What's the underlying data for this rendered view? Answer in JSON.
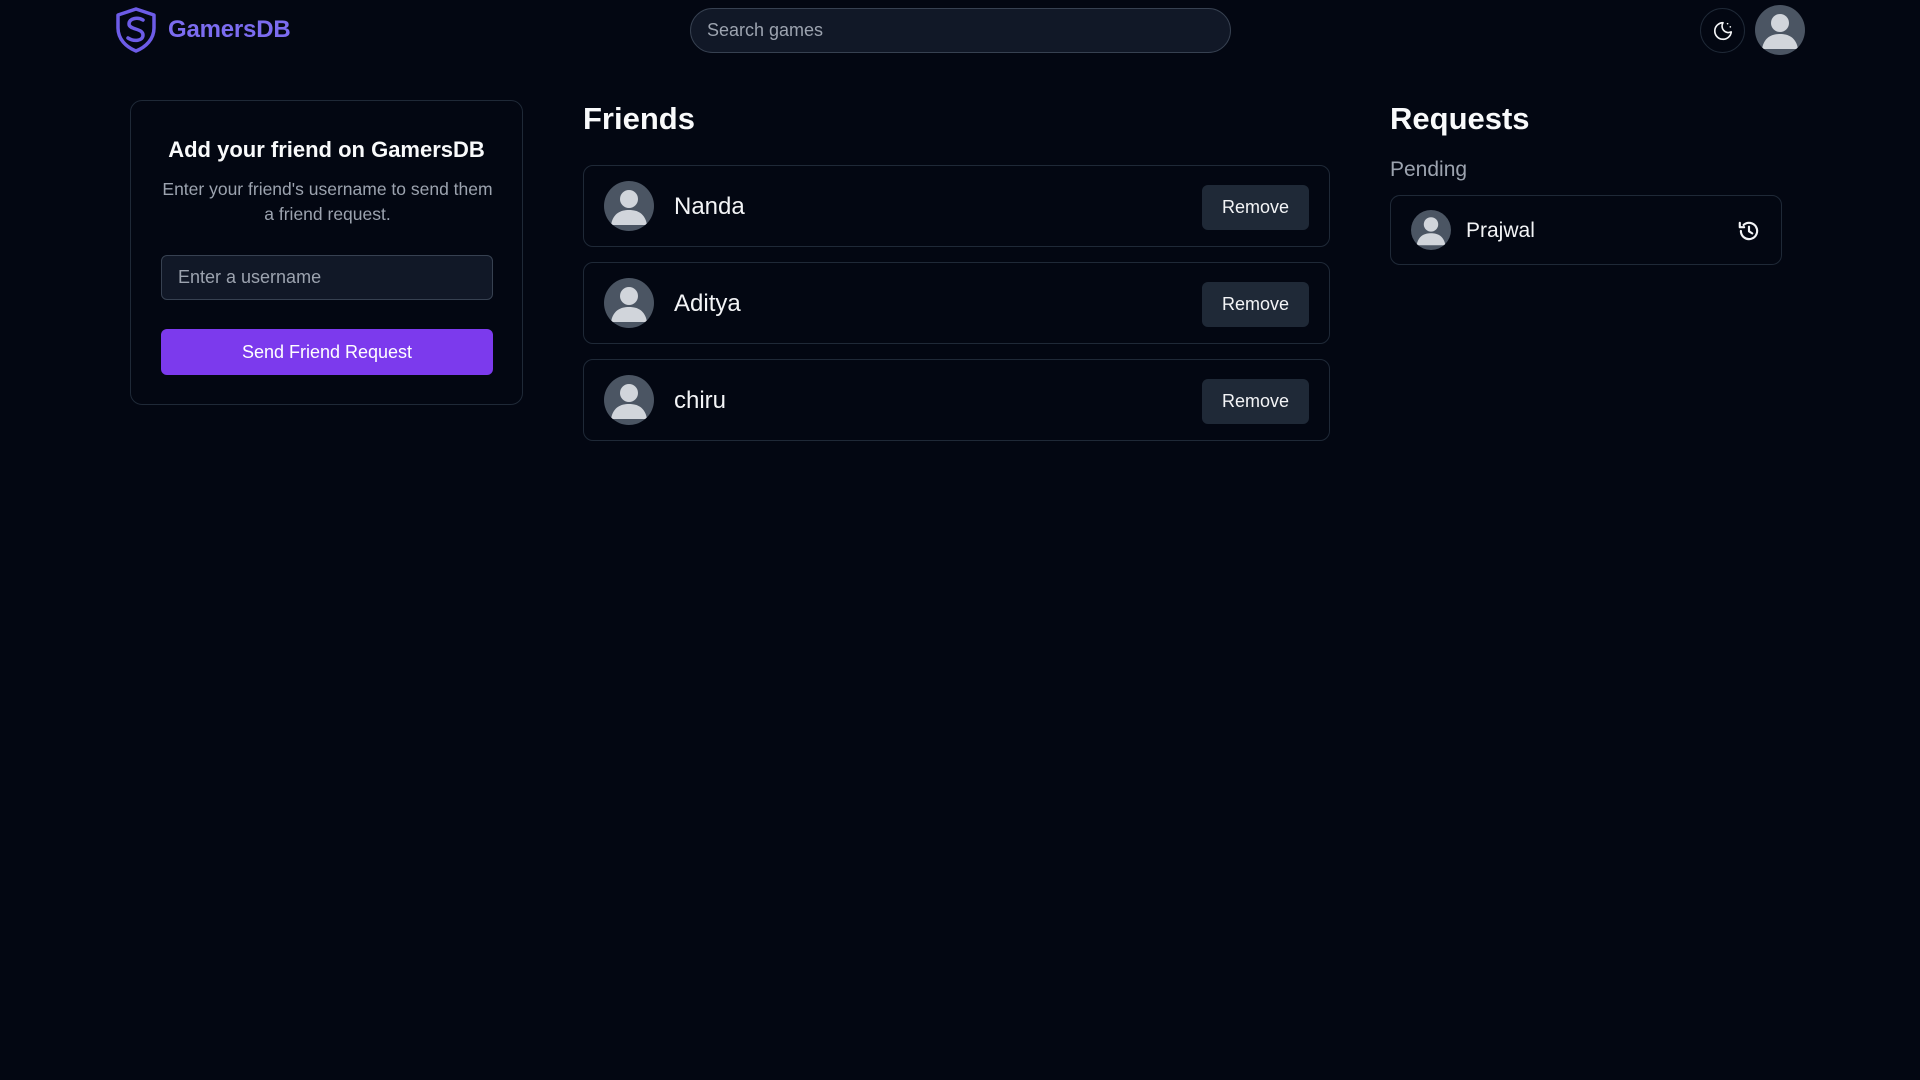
{
  "app": {
    "name": "GamersDB",
    "brand_color": "#7c6cf0",
    "accent_color": "#7c3aed",
    "background_color": "#030712"
  },
  "header": {
    "logo_icon": "shield-icon",
    "search_placeholder": "Search games",
    "theme_toggle_icon": "moon-icon",
    "profile_icon": "user-avatar-icon"
  },
  "add_friend": {
    "title": "Add your friend on GamersDB",
    "description": "Enter your friend's username to send them a friend request.",
    "input_placeholder": "Enter a username",
    "input_value": "",
    "button_label": "Send Friend Request"
  },
  "friends": {
    "title": "Friends",
    "remove_label": "Remove",
    "items": [
      {
        "name": "Nanda"
      },
      {
        "name": "Aditya"
      },
      {
        "name": "chiru"
      }
    ]
  },
  "requests": {
    "title": "Requests",
    "pending_label": "Pending",
    "items": [
      {
        "name": "Prajwal",
        "status_icon": "history-icon"
      }
    ]
  }
}
